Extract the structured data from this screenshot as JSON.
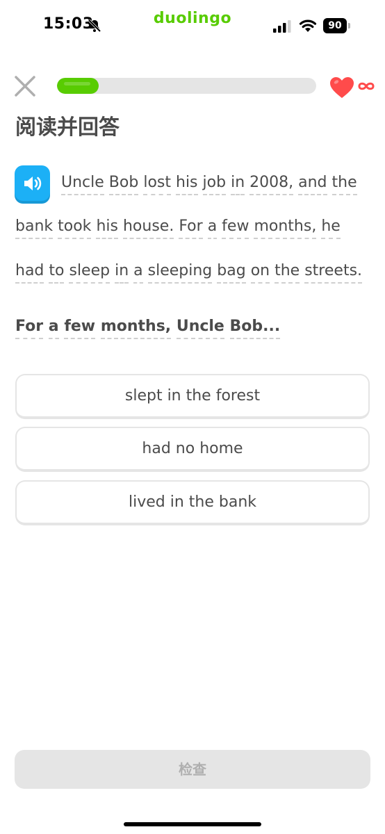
{
  "status_bar": {
    "time": "15:03",
    "app_brand": "duolingo",
    "battery_level": "90",
    "icons": [
      "bell-muted-icon",
      "signal-icon",
      "wifi-icon",
      "battery-icon"
    ]
  },
  "lesson": {
    "progress": 0.16,
    "hearts": "∞",
    "colors": {
      "accent_green": "#58cc02",
      "accent_blue": "#1cb0f6",
      "heart_red": "#ff4b4b",
      "text": "#4b4b4b",
      "disabled": "#afafaf"
    }
  },
  "title": "阅读并回答",
  "passage": {
    "line1": [
      "Uncle",
      "Bob",
      "lost",
      "his",
      "job",
      "in",
      "2008,",
      "and",
      "the"
    ],
    "line2": [
      "bank",
      "took",
      "his",
      "house.",
      "For",
      "a",
      "few",
      "months,",
      "he"
    ],
    "line3": [
      "had",
      "to",
      "sleep",
      "in",
      "a",
      "sleeping",
      "bag",
      "on",
      "the",
      "streets."
    ]
  },
  "question": [
    "For",
    "a",
    "few",
    "months,",
    "Uncle",
    "Bob..."
  ],
  "options": [
    {
      "label": "slept in the forest"
    },
    {
      "label": "had no home"
    },
    {
      "label": "lived in the bank"
    }
  ],
  "check_button": {
    "label": "检查"
  }
}
